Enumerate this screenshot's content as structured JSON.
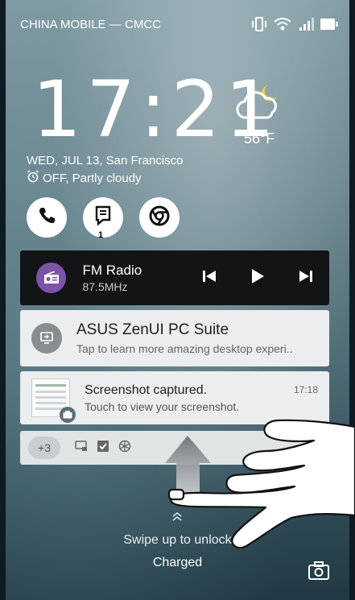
{
  "status_bar": {
    "carrier": "CHINA MOBILE — CMCC",
    "icons": [
      "vibrate-icon",
      "wifi-icon",
      "signal-icon",
      "battery-icon"
    ]
  },
  "lockscreen": {
    "time": "17:21",
    "weather": {
      "icon": "partly-cloudy-night-icon",
      "temperature": "56°F"
    },
    "date_location": "WED, JUL 13, San Francisco",
    "alarm_status": "OFF, Partly cloudy"
  },
  "shortcuts": [
    {
      "icon": "phone-icon"
    },
    {
      "icon": "messages-icon",
      "badge": "1"
    },
    {
      "icon": "chrome-icon"
    }
  ],
  "media": {
    "title": "FM Radio",
    "subtitle": "87.5MHz",
    "accent": "#7a54a8"
  },
  "notifications": [
    {
      "title": "ASUS ZenUI PC Suite",
      "text": "Tap to learn more amazing desktop experi.."
    },
    {
      "title": "Screenshot captured.",
      "text": "Touch to view your screenshot.",
      "time": "17:18"
    }
  ],
  "more_notifications": {
    "count": "+3"
  },
  "footer": {
    "swipe_hint": "Swipe up to unlock",
    "charging": "Charged"
  }
}
